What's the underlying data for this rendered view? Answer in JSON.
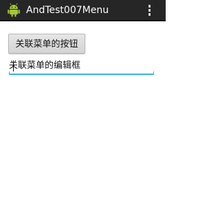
{
  "app": {
    "title": "AndTest007Menu",
    "icon": "android-robot-icon",
    "menu_icon": "overflow-menu-icon"
  },
  "main": {
    "button_label": "关联菜单的按钮",
    "edit_text_value": "关联菜单的编辑框"
  },
  "colors": {
    "action_bar": "#262626",
    "title_text": "#ffffff",
    "edit_underline": "#33b5e5",
    "icon_green": "#a4c639"
  }
}
